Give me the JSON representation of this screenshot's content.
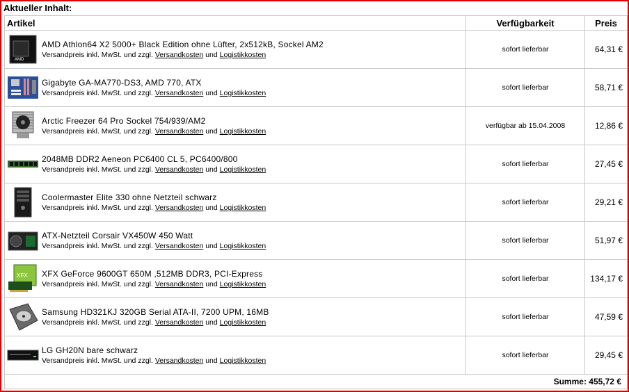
{
  "title": "Aktueller Inhalt:",
  "columns": {
    "article": "Artikel",
    "availability": "Verfügbarkeit",
    "price": "Preis"
  },
  "shipping": {
    "prefix": "Versandpreis inkl. MwSt. und zzgl.",
    "link1": "Versandkosten",
    "and": "und",
    "link2": "Logistikkosten"
  },
  "items": [
    {
      "name": "AMD Athlon64 X2 5000+ Black Edition ohne Lüfter, 2x512kB, Sockel AM2",
      "availability": "sofort lieferbar",
      "price": "64,31 €",
      "icon": "cpu-box-icon"
    },
    {
      "name": "Gigabyte GA-MA770-DS3, AMD 770, ATX",
      "availability": "sofort lieferbar",
      "price": "58,71 €",
      "icon": "mainboard-icon"
    },
    {
      "name": "Arctic Freezer 64 Pro Sockel 754/939/AM2",
      "availability": "verfügbar ab 15.04.2008",
      "price": "12,86 €",
      "icon": "cpu-cooler-icon"
    },
    {
      "name": "2048MB DDR2 Aeneon PC6400 CL 5, PC6400/800",
      "availability": "sofort lieferbar",
      "price": "27,45 €",
      "icon": "ram-module-icon"
    },
    {
      "name": "Coolermaster Elite 330 ohne Netzteil schwarz",
      "availability": "sofort lieferbar",
      "price": "29,21 €",
      "icon": "pc-case-icon"
    },
    {
      "name": "ATX-Netzteil Corsair VX450W 450 Watt",
      "availability": "sofort lieferbar",
      "price": "51,97 €",
      "icon": "power-supply-icon"
    },
    {
      "name": "XFX GeForce 9600GT 650M ,512MB DDR3, PCI-Express",
      "availability": "sofort lieferbar",
      "price": "134,17 €",
      "icon": "graphics-card-icon"
    },
    {
      "name": "Samsung HD321KJ 320GB Serial ATA-II, 7200 UPM, 16MB",
      "availability": "sofort lieferbar",
      "price": "47,59 €",
      "icon": "hard-drive-icon"
    },
    {
      "name": "LG GH20N bare schwarz",
      "availability": "sofort lieferbar",
      "price": "29,45 €",
      "icon": "dvd-drive-icon"
    }
  ],
  "sum": {
    "label": "Summe:",
    "value": "455,72 €"
  }
}
